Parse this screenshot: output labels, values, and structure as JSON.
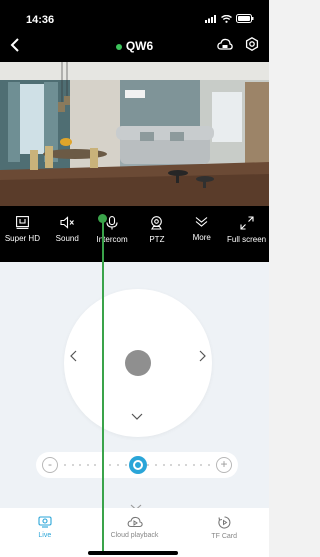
{
  "status_bar": {
    "time": "14:36"
  },
  "header": {
    "title": "QW6"
  },
  "controls": [
    {
      "label": "Super HD"
    },
    {
      "label": "Sound"
    },
    {
      "label": "Intercom"
    },
    {
      "label": "PTZ"
    },
    {
      "label": "More"
    },
    {
      "label": "Full screen"
    }
  ],
  "zoom_slider": {
    "minus": "-",
    "plus": "+",
    "level_fraction": 0.5
  },
  "tabs": [
    {
      "label": "Live",
      "active": true
    },
    {
      "label": "Cloud playback",
      "active": false
    },
    {
      "label": "TF Card",
      "active": false
    }
  ],
  "colors": {
    "accent": "#2aa5d8",
    "online": "#3cc35a"
  }
}
